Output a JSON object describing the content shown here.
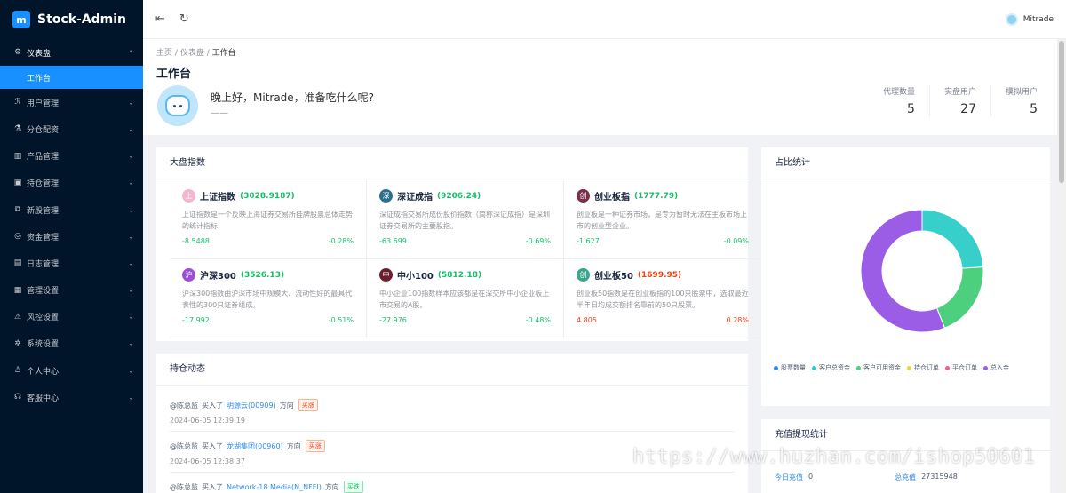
{
  "app": {
    "logo_mark": "m",
    "logo_text": "Stock-Admin"
  },
  "sidebar": {
    "items": [
      {
        "icon": "⚙",
        "label": "仪表盘",
        "arrow": "⌃"
      },
      {
        "label": "工作台"
      },
      {
        "icon": "ℛ",
        "label": "用户管理",
        "arrow": "⌄"
      },
      {
        "icon": "⚗",
        "label": "分仓配资",
        "arrow": "⌄"
      },
      {
        "icon": "▥",
        "label": "产品管理",
        "arrow": "⌄"
      },
      {
        "icon": "▣",
        "label": "持仓管理",
        "arrow": "⌄"
      },
      {
        "icon": "⧉",
        "label": "新股管理",
        "arrow": "⌄"
      },
      {
        "icon": "◎",
        "label": "资金管理",
        "arrow": "⌄"
      },
      {
        "icon": "▤",
        "label": "日志管理",
        "arrow": "⌄"
      },
      {
        "icon": "▦",
        "label": "管理设置",
        "arrow": "⌄"
      },
      {
        "icon": "⚠",
        "label": "风控设置",
        "arrow": "⌄"
      },
      {
        "icon": "✲",
        "label": "系统设置",
        "arrow": "⌄"
      },
      {
        "icon": "♙",
        "label": "个人中心",
        "arrow": "⌄"
      },
      {
        "icon": "☊",
        "label": "客服中心",
        "arrow": "⌄"
      }
    ]
  },
  "topbar": {
    "menu_icon": "⇤",
    "refresh_icon": "↻",
    "user_name": "Mitrade"
  },
  "header": {
    "breadcrumb": [
      "主页",
      "仪表盘",
      "工作台"
    ],
    "breadcrumb_sep": "/",
    "title": "工作台",
    "greeting": "晚上好，Mitrade，准备吃什么呢?",
    "greeting_sub": "——",
    "stats": [
      {
        "label": "代理数量",
        "value": "5"
      },
      {
        "label": "实盘用户",
        "value": "27"
      },
      {
        "label": "模拟用户",
        "value": "5"
      }
    ]
  },
  "market": {
    "title": "大盘指数",
    "indices": [
      {
        "badge": "上",
        "badge_color": "#f5b5cf",
        "name": "上证指数",
        "value": "(3028.9187)",
        "trend": "up",
        "desc": "上证指数是一个反映上海证券交易所挂牌股票总体走势的统计指标",
        "change": "-8.5488",
        "percent": "-0.28%"
      },
      {
        "badge": "深",
        "badge_color": "#2a6f8e",
        "name": "深证成指",
        "value": "(9206.24)",
        "trend": "up",
        "desc": "深证成指交易所成份股价指数（简称深证成指）是深圳证券交易所的主要股指。",
        "change": "-63.699",
        "percent": "-0.69%"
      },
      {
        "badge": "创",
        "badge_color": "#7a2e4a",
        "name": "创业板指",
        "value": "(1777.79)",
        "trend": "up",
        "desc": "创业板是一种证券市场，是专为暂时无法在主板市场上市的创业型企业。",
        "change": "-1.627",
        "percent": "-0.09%"
      },
      {
        "badge": "沪",
        "badge_color": "#9c4fd6",
        "name": "沪深300",
        "value": "(3526.13)",
        "trend": "up",
        "desc": "沪深300指数由沪深市场中规模大、流动性好的最具代表性的300只证券组成。",
        "change": "-17.992",
        "percent": "-0.51%"
      },
      {
        "badge": "中",
        "badge_color": "#6b1f2e",
        "name": "中小100",
        "value": "(5812.18)",
        "trend": "up",
        "desc": "中小企业100指数样本应该都是在深交所中小企业板上市交易的A股。",
        "change": "-27.976",
        "percent": "-0.48%"
      },
      {
        "badge": "创",
        "badge_color": "#3aa58a",
        "name": "创业板50",
        "value": "(1699.95)",
        "trend": "down",
        "desc": "创业板50指数是在创业板指的100只股票中，选取最近半年日均成交额排名靠前的50只股票。",
        "change": "4.805",
        "percent": "0.28%"
      }
    ]
  },
  "positions": {
    "title": "持仓动态",
    "items": [
      {
        "user": "@陈总监",
        "action": "买入了",
        "stock": "明源云(00909)",
        "dir_label": "方向",
        "tag": "买涨",
        "tag_type": "red",
        "time": "2024-06-05 12:39:19"
      },
      {
        "user": "@陈总监",
        "action": "买入了",
        "stock": "龙湖集团(00960)",
        "dir_label": "方向",
        "tag": "买涨",
        "tag_type": "red",
        "time": "2024-06-05 12:38:37"
      },
      {
        "user": "@陈总监",
        "action": "买入了",
        "stock": "Network-18 Media(N_NFFI)",
        "dir_label": "方向",
        "tag": "买跌",
        "tag_type": "green",
        "time": ""
      }
    ]
  },
  "ratio": {
    "title": "占比统计",
    "legend": [
      {
        "label": "股票数量",
        "color": "#2d8cf0"
      },
      {
        "label": "客户总资金",
        "color": "#2ec7c9"
      },
      {
        "label": "客户可用资金",
        "color": "#4cd07d"
      },
      {
        "label": "持仓订单",
        "color": "#f7ce3e"
      },
      {
        "label": "平仓订单",
        "color": "#f25e8a"
      },
      {
        "label": "总入金",
        "color": "#9b5de5"
      }
    ]
  },
  "chart_data": {
    "type": "pie",
    "title": "",
    "slices": [
      {
        "label": "客户总资金",
        "value": 24,
        "color": "#36cfc9"
      },
      {
        "label": "客户可用资金",
        "value": 20,
        "color": "#4cd07d"
      },
      {
        "label": "总入金",
        "value": 56,
        "color": "#9b5de5"
      }
    ]
  },
  "recharge": {
    "title": "充值提现统计",
    "today_label": "今日充值",
    "today_value": "0",
    "total_label": "总充值",
    "total_value": "27315948"
  },
  "watermark": "https://www.huzhan.com/ishop50601"
}
